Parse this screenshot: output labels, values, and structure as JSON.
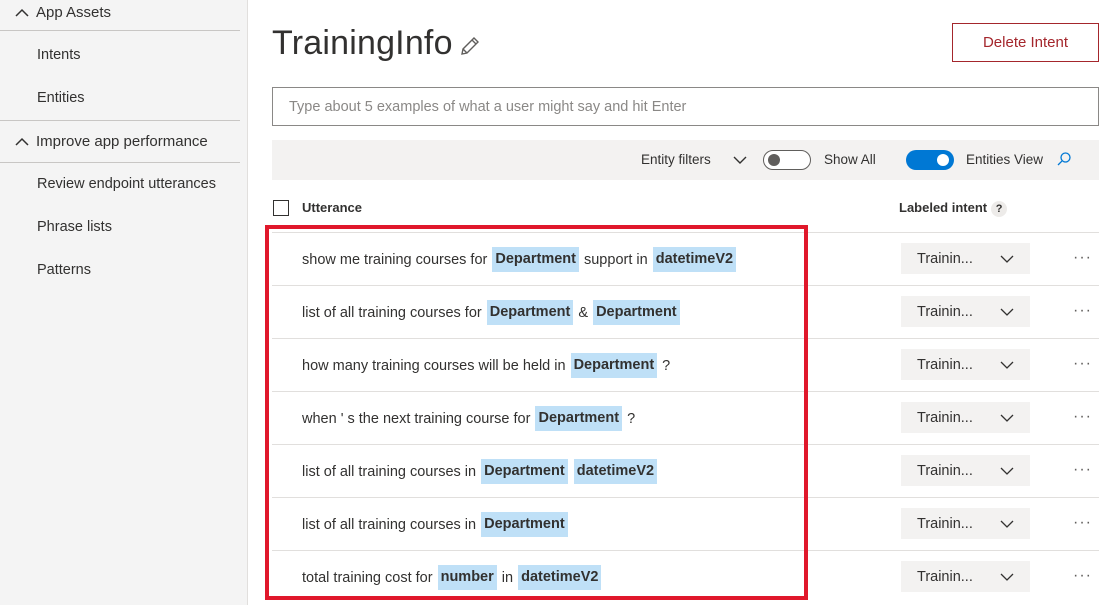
{
  "sidebar": {
    "sections": [
      {
        "label": "App Assets",
        "items": [
          "Intents",
          "Entities"
        ]
      },
      {
        "label": "Improve app performance",
        "items": [
          "Review endpoint utterances",
          "Phrase lists",
          "Patterns"
        ]
      }
    ]
  },
  "page": {
    "title": "TrainingInfo",
    "delete_label": "Delete Intent",
    "input_placeholder": "Type about 5 examples of what a user might say and hit Enter"
  },
  "filters": {
    "entity_filters": "Entity filters",
    "show_all": "Show All",
    "entities_view": "Entities View"
  },
  "table": {
    "col_utterance": "Utterance",
    "col_labeled_intent": "Labeled intent",
    "help_mark": "?",
    "rows": [
      {
        "parts": [
          {
            "t": "show me training courses for "
          },
          {
            "e": "Department"
          },
          {
            "t": " support in "
          },
          {
            "e": "datetimeV2"
          }
        ],
        "intent": "Trainin..."
      },
      {
        "parts": [
          {
            "t": "list of all training courses for "
          },
          {
            "e": "Department"
          },
          {
            "t": " & "
          },
          {
            "e": "Department"
          }
        ],
        "intent": "Trainin..."
      },
      {
        "parts": [
          {
            "t": "how many training courses will be held in "
          },
          {
            "e": "Department"
          },
          {
            "t": " ?"
          }
        ],
        "intent": "Trainin..."
      },
      {
        "parts": [
          {
            "t": "when ' s the next training course for "
          },
          {
            "e": "Department"
          },
          {
            "t": " ?"
          }
        ],
        "intent": "Trainin..."
      },
      {
        "parts": [
          {
            "t": "list of all training courses in "
          },
          {
            "e": "Department"
          },
          {
            "t": " "
          },
          {
            "e": "datetimeV2"
          }
        ],
        "intent": "Trainin..."
      },
      {
        "parts": [
          {
            "t": "list of all training courses in "
          },
          {
            "e": "Department"
          }
        ],
        "intent": "Trainin..."
      },
      {
        "parts": [
          {
            "t": "total training cost for "
          },
          {
            "e": "number"
          },
          {
            "t": " in "
          },
          {
            "e": "datetimeV2"
          }
        ],
        "intent": "Trainin..."
      }
    ],
    "more_label": "···"
  },
  "colors": {
    "entity_highlight": "#bfe0f7",
    "delete_accent": "#a4262c",
    "toggle_on": "#0078d4",
    "annotation_box": "#e0182b"
  },
  "icons": {
    "collapse": "chevron-up-icon",
    "edit": "pencil-icon",
    "filter_dropdown": "chevron-down-icon",
    "search": "search-icon",
    "row_menu": "more-icon"
  }
}
